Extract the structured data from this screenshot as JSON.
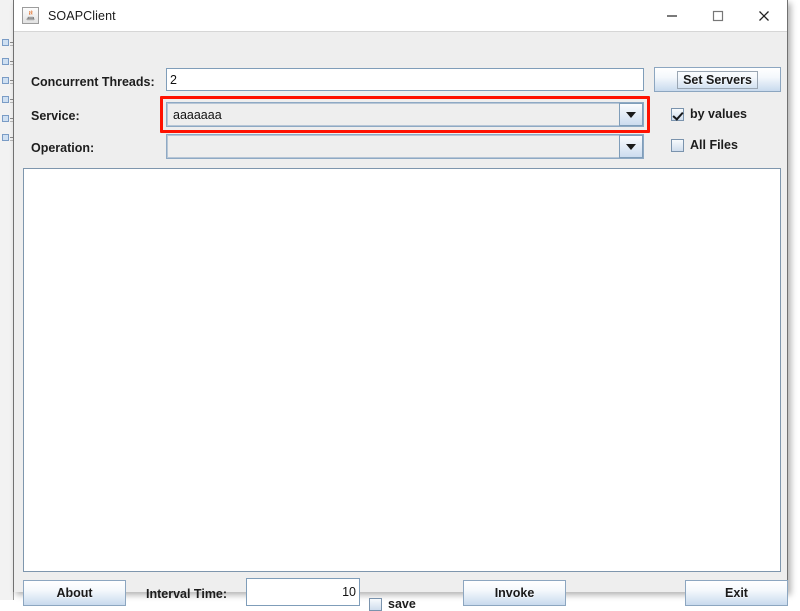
{
  "window": {
    "title": "SOAPClient",
    "icon": "java-coffee-cup-icon",
    "controls": {
      "minimize": "minimize-icon",
      "maximize": "maximize-icon",
      "close": "close-icon"
    }
  },
  "form": {
    "threads": {
      "label": "Concurrent Threads:",
      "value": "2"
    },
    "service": {
      "label": "Service:",
      "value": "aaaaaaa",
      "arrow_icon": "chevron-down-icon",
      "highlighted": true
    },
    "operation": {
      "label": "Operation:",
      "value": "",
      "arrow_icon": "chevron-down-icon"
    }
  },
  "side_controls": {
    "set_servers_label": "Set Servers",
    "by_values": {
      "label": "by values",
      "checked": true
    },
    "all_files": {
      "label": "All Files",
      "checked": false
    }
  },
  "output": {
    "text": ""
  },
  "footer": {
    "about_label": "About",
    "interval": {
      "label": "Interval Time:",
      "value": "10"
    },
    "save": {
      "label": "save",
      "checked": false
    },
    "invoke_label": "Invoke",
    "exit_label": "Exit"
  },
  "colors": {
    "highlight": "#ff1100",
    "window_bg": "#eeeeee",
    "field_border": "#7f9db9",
    "panel_bg": "#ffffff"
  }
}
